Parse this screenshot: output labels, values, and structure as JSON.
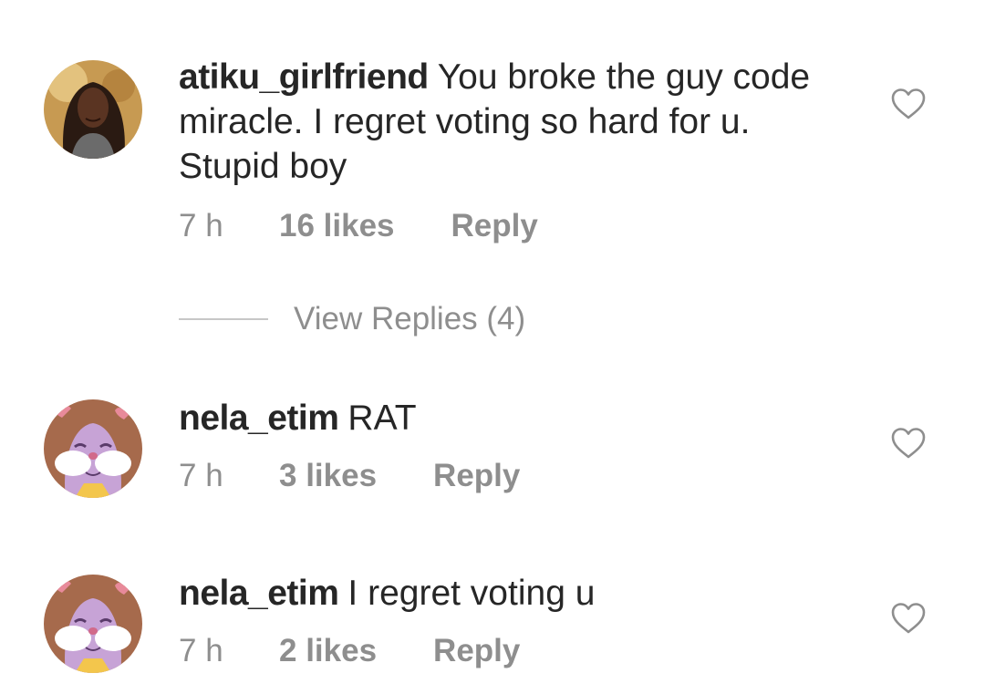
{
  "comments": [
    {
      "username": "atiku_girlfriend",
      "text": "You broke the guy code miracle. I regret voting so hard for u. Stupid boy",
      "time": "7 h",
      "likes": "16 likes",
      "reply_label": "Reply",
      "avatar_icon": "profile-photo"
    },
    {
      "username": "nela_etim",
      "text": "RAT",
      "time": "7 h",
      "likes": "3 likes",
      "reply_label": "Reply",
      "avatar_icon": "cartoon-bunny"
    },
    {
      "username": "nela_etim",
      "text": "I regret voting u",
      "time": "7 h",
      "likes": "2 likes",
      "reply_label": "Reply",
      "avatar_icon": "cartoon-bunny"
    }
  ],
  "view_replies": {
    "label": "View Replies (4)"
  },
  "colors": {
    "text_primary": "#262626",
    "text_secondary": "#8e8e8e",
    "divider": "#c7c7c7",
    "heart_outline": "#8e8e8e"
  }
}
